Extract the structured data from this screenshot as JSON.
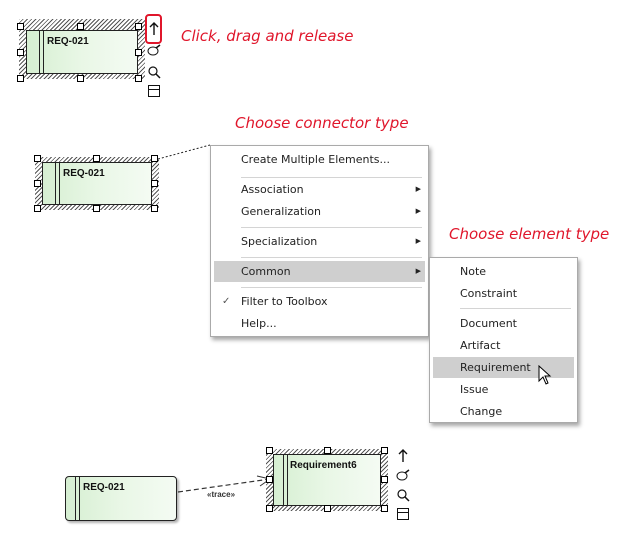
{
  "annotations": {
    "step1": "Click, drag and release",
    "step2": "Choose connector type",
    "step3": "Choose element type"
  },
  "step1_element": {
    "name": "REQ-021"
  },
  "step2_element": {
    "name": "REQ-021"
  },
  "quicklinker_icons": [
    "up-arrow-icon",
    "lasso-icon",
    "magnifier-icon",
    "layout-icon"
  ],
  "connector_menu": {
    "items": [
      {
        "label": "Create Multiple Elements...",
        "submenu": false
      },
      {
        "label": "Association",
        "submenu": true
      },
      {
        "label": "Generalization",
        "submenu": true
      },
      {
        "label": "Specialization",
        "submenu": true
      },
      {
        "label": "Common",
        "submenu": true,
        "highlighted": true
      },
      {
        "label": "Filter to Toolbox",
        "checked": true
      },
      {
        "label": "Help..."
      }
    ]
  },
  "element_menu": {
    "items": [
      {
        "label": "Note"
      },
      {
        "label": "Constraint"
      },
      {
        "label": "Document"
      },
      {
        "label": "Artifact"
      },
      {
        "label": "Requirement",
        "highlighted": true
      },
      {
        "label": "Issue"
      },
      {
        "label": "Change"
      }
    ]
  },
  "result": {
    "source": "REQ-021",
    "target": "Requirement6",
    "connector_label": "«trace»"
  },
  "colors": {
    "annotation_red": "#e0162b",
    "highlight_box": "#e0162b",
    "menu_highlight": "#cfcfcf"
  }
}
